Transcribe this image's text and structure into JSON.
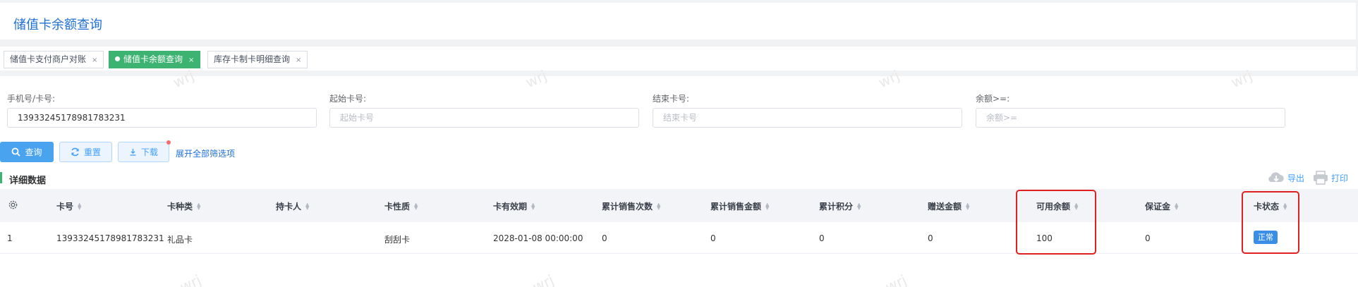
{
  "page": {
    "title": "储值卡余额查询"
  },
  "tabs": [
    {
      "label": "储值卡支付商户对账",
      "close": "×"
    },
    {
      "label": "储值卡余额查询",
      "close": "×"
    },
    {
      "label": "库存卡制卡明细查询",
      "close": "×"
    }
  ],
  "filters": {
    "phone_card": {
      "label": "手机号/卡号:",
      "value": "13933245178981783231"
    },
    "start_card": {
      "label": "起始卡号:",
      "placeholder": "起始卡号"
    },
    "end_card": {
      "label": "结束卡号:",
      "placeholder": "结束卡号"
    },
    "balance": {
      "label": "余额>=:",
      "placeholder": "余额>="
    }
  },
  "actions": {
    "search": "查询",
    "reset": "重置",
    "download": "下载",
    "expand": "展开全部筛选项"
  },
  "section": {
    "title": "详细数据",
    "export": "导出",
    "print": "打印"
  },
  "table": {
    "columns": [
      "卡号",
      "卡种类",
      "持卡人",
      "卡性质",
      "卡有效期",
      "累计销售次数",
      "累计销售金额",
      "累计积分",
      "赠送金额",
      "可用余额",
      "保证金",
      "卡状态"
    ],
    "rows": [
      {
        "index": "1",
        "card_no": "13933245178981783231",
        "card_type": "礼品卡",
        "holder": "",
        "card_nature": "刮刮卡",
        "expiry": "2028-01-08 00:00:00",
        "sales_count": "0",
        "sales_amount": "0",
        "points": "0",
        "gift_amount": "0",
        "available_balance": "100",
        "deposit": "0",
        "status": "正常"
      }
    ]
  },
  "colors": {
    "accent": "#1e6fd6",
    "tab_active": "#3cb371",
    "primary_button": "#4aa3ef",
    "status_badge": "#3a8ee6",
    "highlight": "#e02020"
  },
  "watermark": "wrj"
}
